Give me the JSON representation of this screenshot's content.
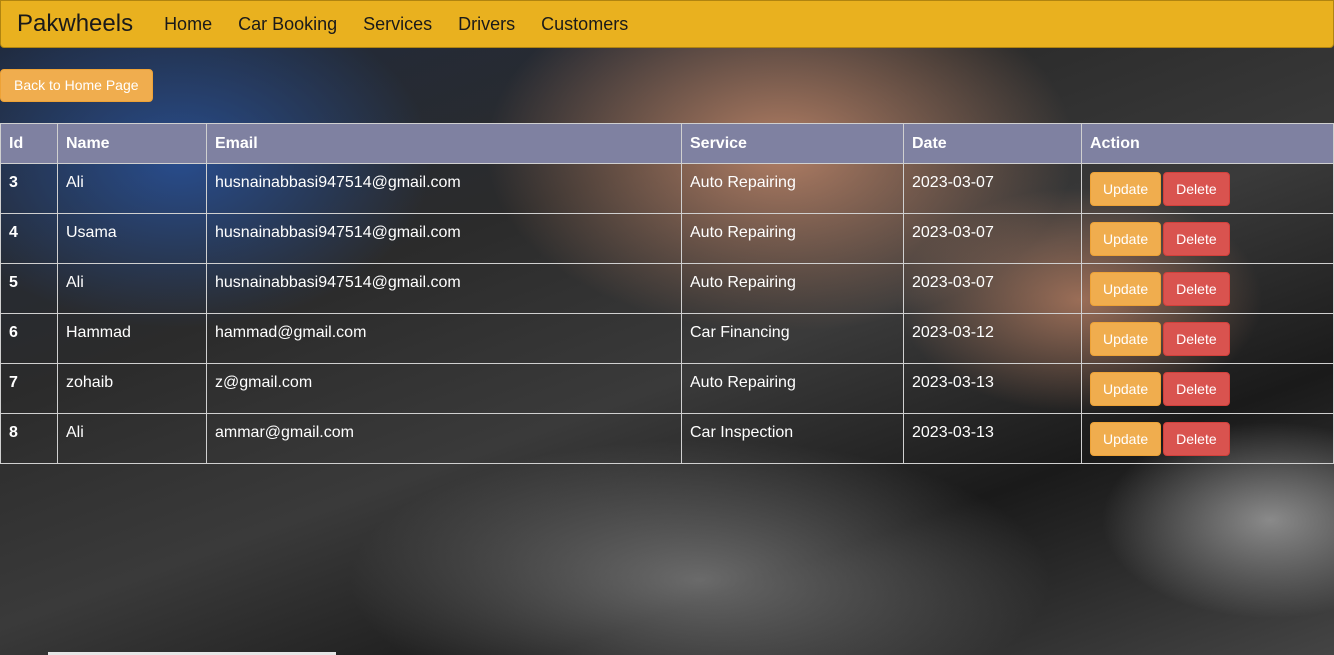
{
  "navbar": {
    "brand": "Pakwheels",
    "links": [
      "Home",
      "Car Booking",
      "Services",
      "Drivers",
      "Customers"
    ]
  },
  "back_button": "Back to Home Page",
  "table": {
    "headers": [
      "Id",
      "Name",
      "Email",
      "Service",
      "Date",
      "Action"
    ],
    "update_label": "Update",
    "delete_label": "Delete",
    "rows": [
      {
        "id": "3",
        "name": "Ali",
        "email": "husnainabbasi947514@gmail.com",
        "service": "Auto Repairing",
        "date": "2023-03-07"
      },
      {
        "id": "4",
        "name": "Usama",
        "email": "husnainabbasi947514@gmail.com",
        "service": "Auto Repairing",
        "date": "2023-03-07"
      },
      {
        "id": "5",
        "name": "Ali",
        "email": "husnainabbasi947514@gmail.com",
        "service": "Auto Repairing",
        "date": "2023-03-07"
      },
      {
        "id": "6",
        "name": "Hammad",
        "email": "hammad@gmail.com",
        "service": "Car Financing",
        "date": "2023-03-12"
      },
      {
        "id": "7",
        "name": "zohaib",
        "email": "z@gmail.com",
        "service": "Auto Repairing",
        "date": "2023-03-13"
      },
      {
        "id": "8",
        "name": "Ali",
        "email": "ammar@gmail.com",
        "service": "Car Inspection",
        "date": "2023-03-13"
      }
    ]
  },
  "colors": {
    "navbar": "#e9b11f",
    "header_row": "#7f81a1",
    "update_button": "#f0ad4e",
    "delete_button": "#d9534f"
  }
}
